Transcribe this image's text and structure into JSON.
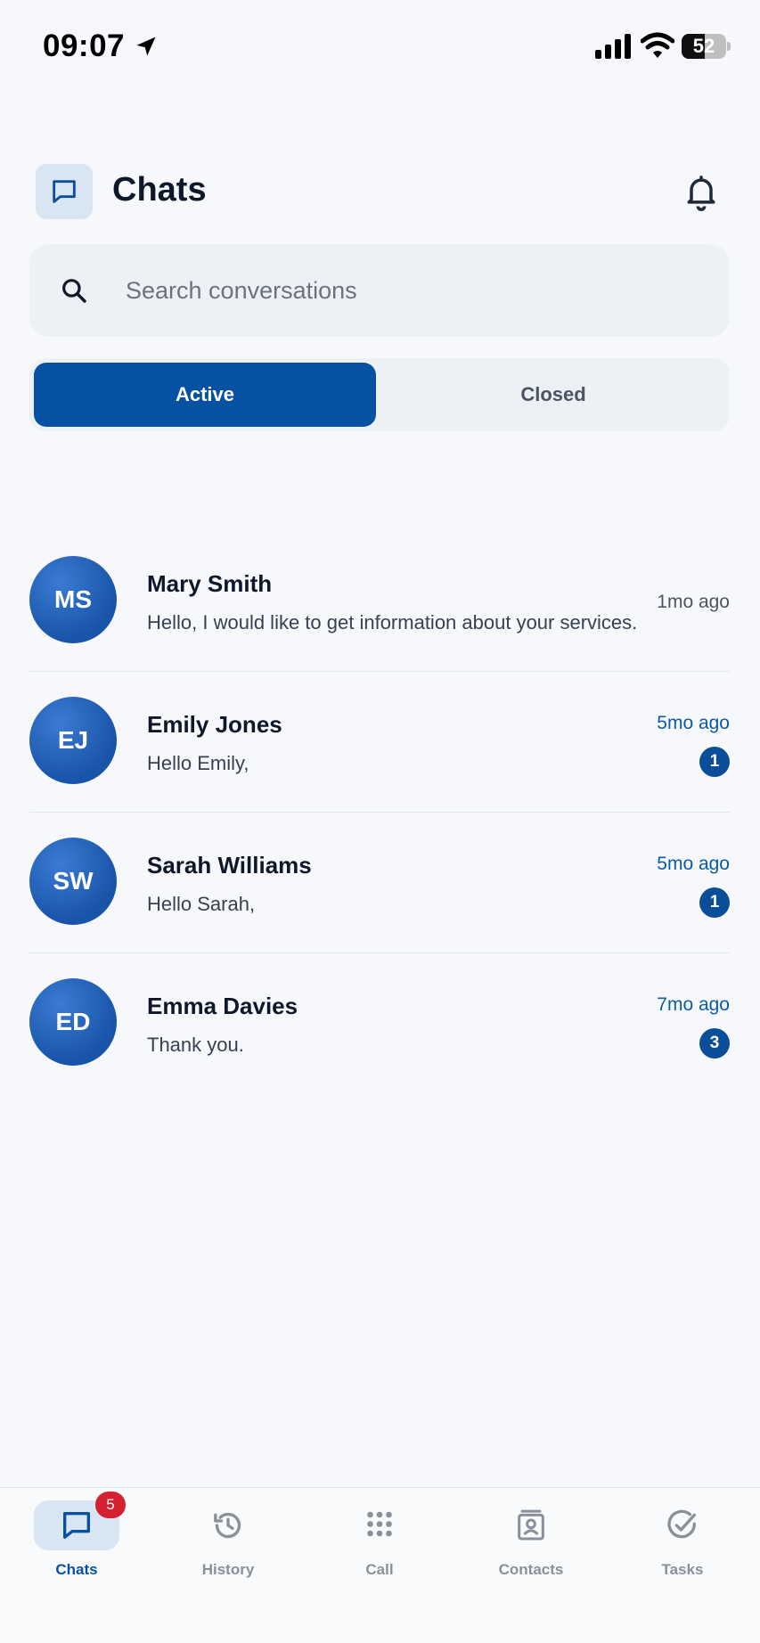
{
  "status_bar": {
    "time": "09:07",
    "battery": "52"
  },
  "header": {
    "title": "Chats"
  },
  "search": {
    "placeholder": "Search conversations"
  },
  "segments": {
    "active": "Active",
    "closed": "Closed"
  },
  "conversations": [
    {
      "initials": "MS",
      "name": "Mary Smith",
      "preview": "Hello, I would like to get information about your services.",
      "time": "1mo ago"
    },
    {
      "initials": "EJ",
      "name": "Emily Jones",
      "preview": "Hello Emily,",
      "time": "5mo ago",
      "unread": "1"
    },
    {
      "initials": "SW",
      "name": "Sarah Williams",
      "preview": "Hello Sarah,",
      "time": "5mo ago",
      "unread": "1"
    },
    {
      "initials": "ED",
      "name": "Emma Davies",
      "preview": "Thank you.",
      "time": "7mo ago",
      "unread": "3"
    }
  ],
  "tabs": [
    {
      "label": "Chats",
      "icon": "chat-icon",
      "badge": "5"
    },
    {
      "label": "History",
      "icon": "history-icon"
    },
    {
      "label": "Call",
      "icon": "dialpad-icon"
    },
    {
      "label": "Contacts",
      "icon": "contacts-icon"
    },
    {
      "label": "Tasks",
      "icon": "tasks-icon"
    }
  ],
  "colors": {
    "primary": "#0751a3",
    "avatar": "#1854a8",
    "badge": "#d42030",
    "background": "#f6f8fb"
  }
}
